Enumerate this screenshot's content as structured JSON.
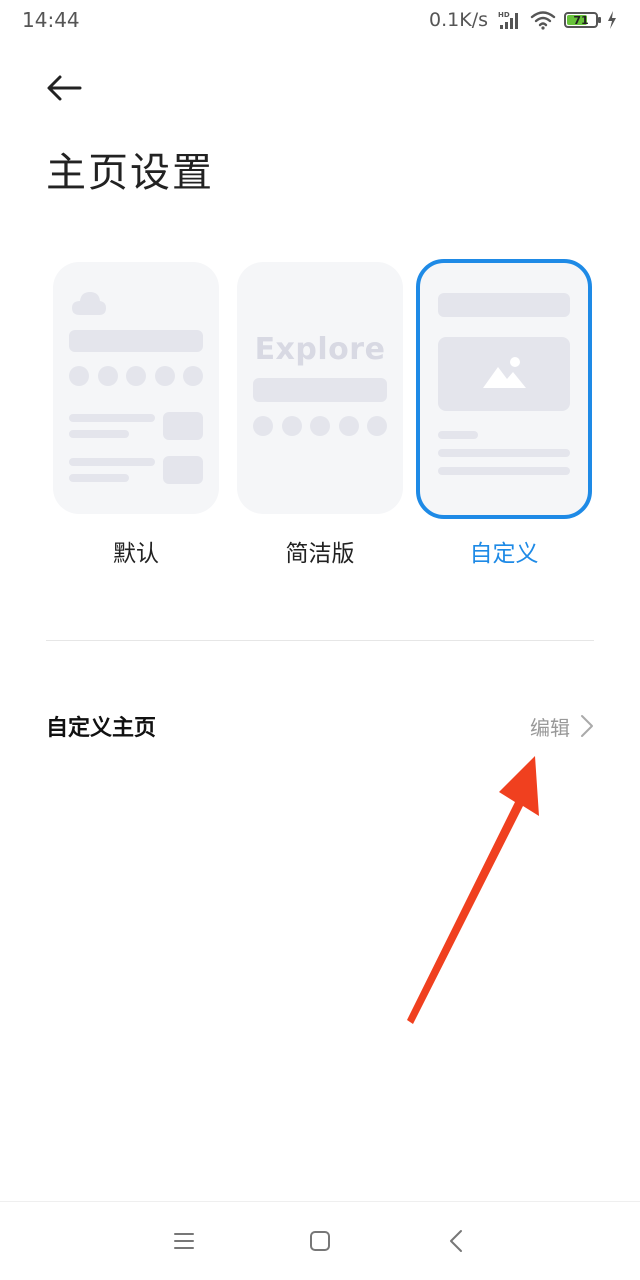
{
  "status_bar": {
    "time": "14:44",
    "network_speed": "0.1K/s",
    "network_tag": "HD",
    "battery_level": "71",
    "battery_fraction": 0.71,
    "icons": [
      "signal-icon",
      "wifi-icon",
      "battery-icon",
      "charging-icon"
    ]
  },
  "header": {
    "back_icon": "back-arrow-icon",
    "title": "主页设置"
  },
  "layout_options": [
    {
      "label": "默认",
      "selected": false
    },
    {
      "label": "简洁版",
      "preview_text": "Explore",
      "selected": false
    },
    {
      "label": "自定义",
      "selected": true
    }
  ],
  "colors": {
    "accent": "#1e8ae6",
    "annotation": "#f0401f"
  },
  "custom_home_row": {
    "title": "自定义主页",
    "action_label": "编辑",
    "action_icon": "chevron-right-icon"
  },
  "nav_bar": {
    "icons": [
      "menu-icon",
      "home-icon",
      "back-icon"
    ]
  }
}
